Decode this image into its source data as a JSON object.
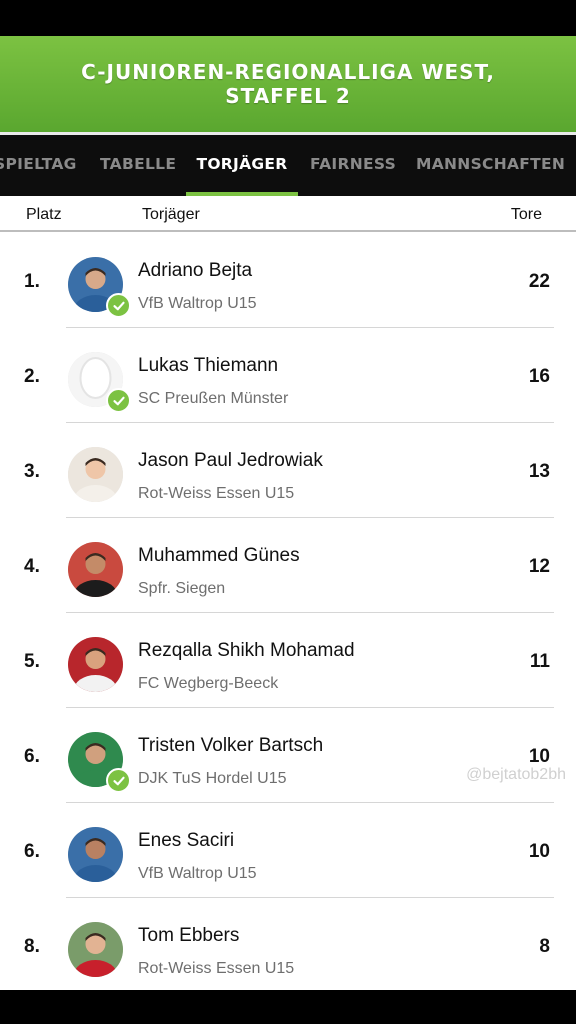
{
  "banner": {
    "line1": "C-JUNIOREN-REGIONALLIGA WEST,",
    "line2": "STAFFEL 2"
  },
  "tabs": [
    {
      "label": "SPIELTAG",
      "active": false
    },
    {
      "label": "TABELLE",
      "active": false
    },
    {
      "label": "TORJÄGER",
      "active": true
    },
    {
      "label": "FAIRNESS",
      "active": false
    },
    {
      "label": "MANNSCHAFTEN",
      "active": false
    }
  ],
  "columns": {
    "platz": "Platz",
    "torjaeger": "Torjäger",
    "tore": "Tore"
  },
  "players": [
    {
      "rank": "1.",
      "name": "Adriano Bejta",
      "club": "VfB Waltrop U15",
      "goals": "22",
      "verified": true,
      "avatar": "photo"
    },
    {
      "rank": "2.",
      "name": "Lukas Thiemann",
      "club": "SC Preußen Münster",
      "goals": "16",
      "verified": true,
      "avatar": "placeholder"
    },
    {
      "rank": "3.",
      "name": "Jason Paul Jedrowiak",
      "club": "Rot-Weiss Essen U15",
      "goals": "13",
      "verified": false,
      "avatar": "photo"
    },
    {
      "rank": "4.",
      "name": "Muhammed Günes",
      "club": "Spfr. Siegen",
      "goals": "12",
      "verified": false,
      "avatar": "photo"
    },
    {
      "rank": "5.",
      "name": "Rezqalla Shikh Mohamad",
      "club": "FC Wegberg-Beeck",
      "goals": "11",
      "verified": false,
      "avatar": "photo"
    },
    {
      "rank": "6.",
      "name": "Tristen Volker Bartsch",
      "club": "DJK TuS Hordel U15",
      "goals": "10",
      "verified": true,
      "avatar": "photo"
    },
    {
      "rank": "6.",
      "name": "Enes Saciri",
      "club": "VfB Waltrop U15",
      "goals": "10",
      "verified": false,
      "avatar": "photo"
    },
    {
      "rank": "8.",
      "name": "Tom Ebbers",
      "club": "Rot-Weiss Essen U15",
      "goals": "8",
      "verified": false,
      "avatar": "photo"
    }
  ],
  "watermark": "@bejtatob2bh",
  "colors": {
    "accent": "#7cc242",
    "tabs_bg": "#0d0d0d"
  }
}
